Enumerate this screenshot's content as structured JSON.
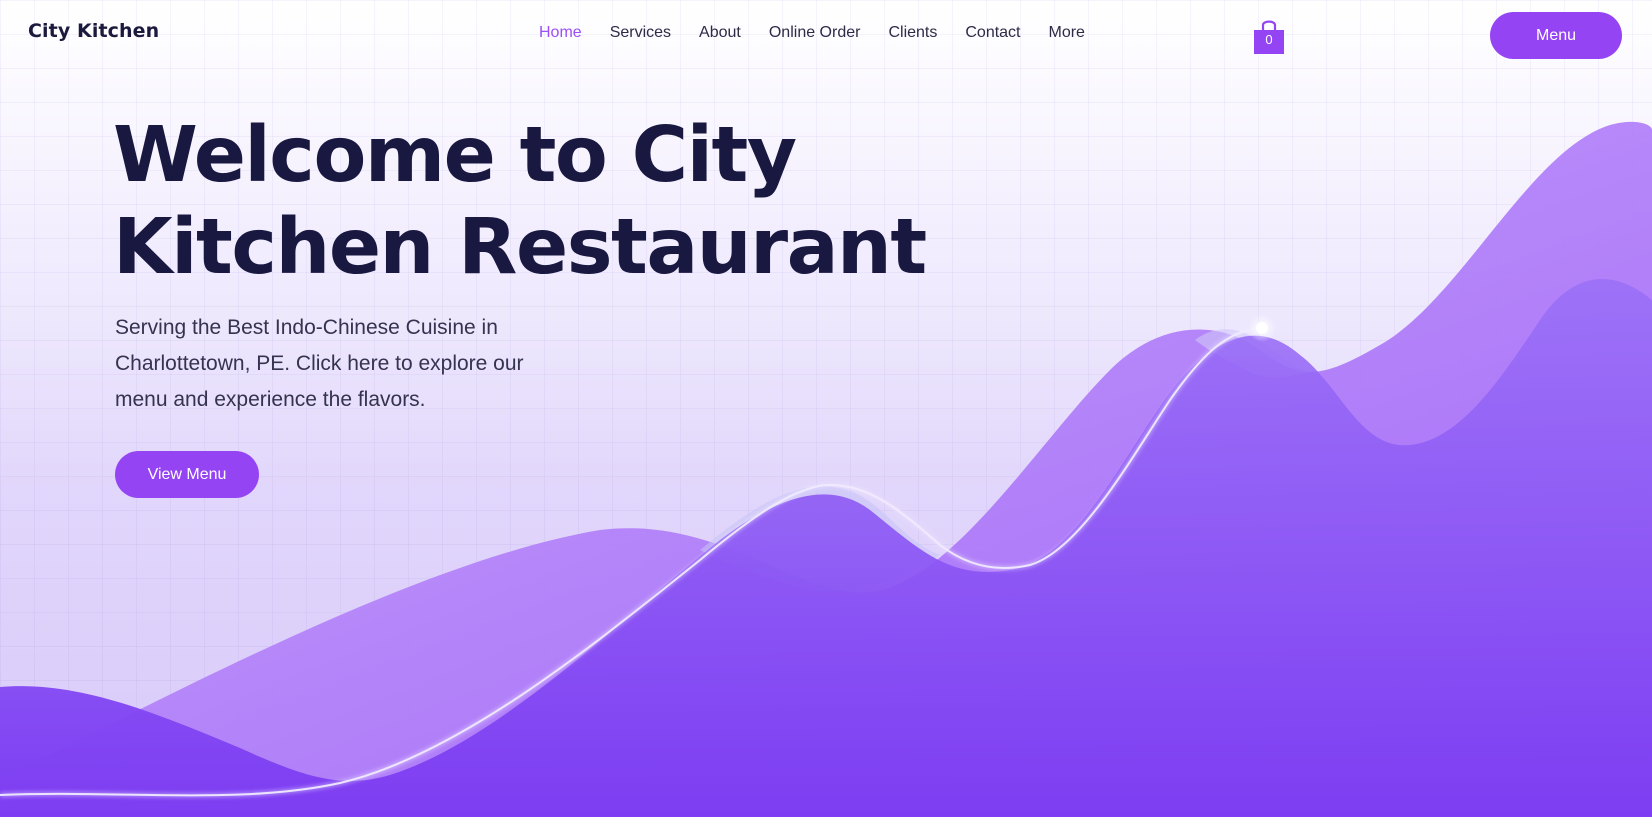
{
  "header": {
    "brand": "City Kitchen",
    "nav": [
      {
        "label": "Home",
        "active": true
      },
      {
        "label": "Services",
        "active": false
      },
      {
        "label": "About",
        "active": false
      },
      {
        "label": "Online Order",
        "active": false
      },
      {
        "label": "Clients",
        "active": false
      },
      {
        "label": "Contact",
        "active": false
      },
      {
        "label": "More",
        "active": false
      }
    ],
    "cart": {
      "icon": "shopping-bag-icon",
      "count": "0"
    },
    "menu_button": "Menu"
  },
  "hero": {
    "title_line1": "Welcome to City",
    "title_line2": "Kitchen Restaurant",
    "subtitle": "Serving the Best Indo-Chinese Cuisine in Charlottetown, PE. Click here to explore our menu and experience the flavors.",
    "cta": "View Menu"
  },
  "colors": {
    "accent": "#9544f3",
    "nav_active": "#9b4ff5",
    "heading": "#191840",
    "text": "#35334f"
  }
}
